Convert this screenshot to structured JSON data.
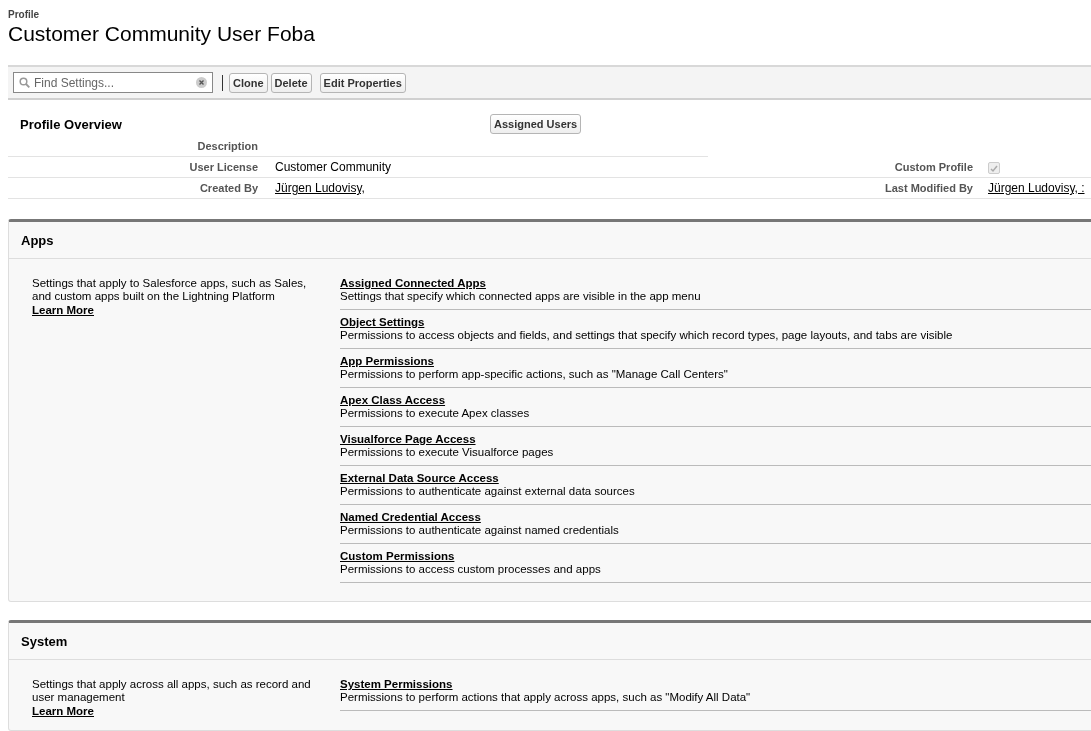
{
  "header": {
    "label": "Profile",
    "title": "Customer Community User Foba"
  },
  "toolbar": {
    "search": {
      "placeholder": "Find Settings..."
    },
    "buttons": [
      "Clone",
      "Delete",
      "Edit Properties"
    ]
  },
  "overview": {
    "title": "Profile Overview",
    "button": "Assigned Users",
    "fields": [
      {
        "label": "Description"
      },
      {
        "label": "User License",
        "value": "Customer Community",
        "kind": "text"
      },
      {
        "label": "Created By",
        "value": "Jürgen Ludovisy,",
        "kind": "link"
      }
    ],
    "side_fields": [
      {
        "label": "Custom Profile",
        "kind": "checkbox",
        "checked": true
      },
      {
        "label": "Last Modified By",
        "value": "Jürgen Ludovisy, :",
        "kind": "link"
      }
    ]
  },
  "sections": [
    {
      "title": "Apps",
      "description": "Settings that apply to Salesforce apps, such as Sales, and custom apps built on the Lightning Platform",
      "learn_more": "Learn More",
      "items": [
        {
          "title": "Assigned Connected Apps",
          "description": "Settings that specify which connected apps are visible in the app menu"
        },
        {
          "title": "Object Settings",
          "description": "Permissions to access objects and fields, and settings that specify which record types, page layouts, and tabs are visible"
        },
        {
          "title": "App Permissions",
          "description": "Permissions to perform app-specific actions, such as \"Manage Call Centers\""
        },
        {
          "title": "Apex Class Access",
          "description": "Permissions to execute Apex classes"
        },
        {
          "title": "Visualforce Page Access",
          "description": "Permissions to execute Visualforce pages"
        },
        {
          "title": "External Data Source Access",
          "description": "Permissions to authenticate against external data sources"
        },
        {
          "title": "Named Credential Access",
          "description": "Permissions to authenticate against named credentials"
        },
        {
          "title": "Custom Permissions",
          "description": "Permissions to access custom processes and apps"
        }
      ]
    },
    {
      "title": "System",
      "description": "Settings that apply across all apps, such as record and user management",
      "learn_more": "Learn More",
      "items": [
        {
          "title": "System Permissions",
          "description": "Permissions to perform actions that apply across apps, such as \"Modify All Data\""
        }
      ]
    }
  ]
}
